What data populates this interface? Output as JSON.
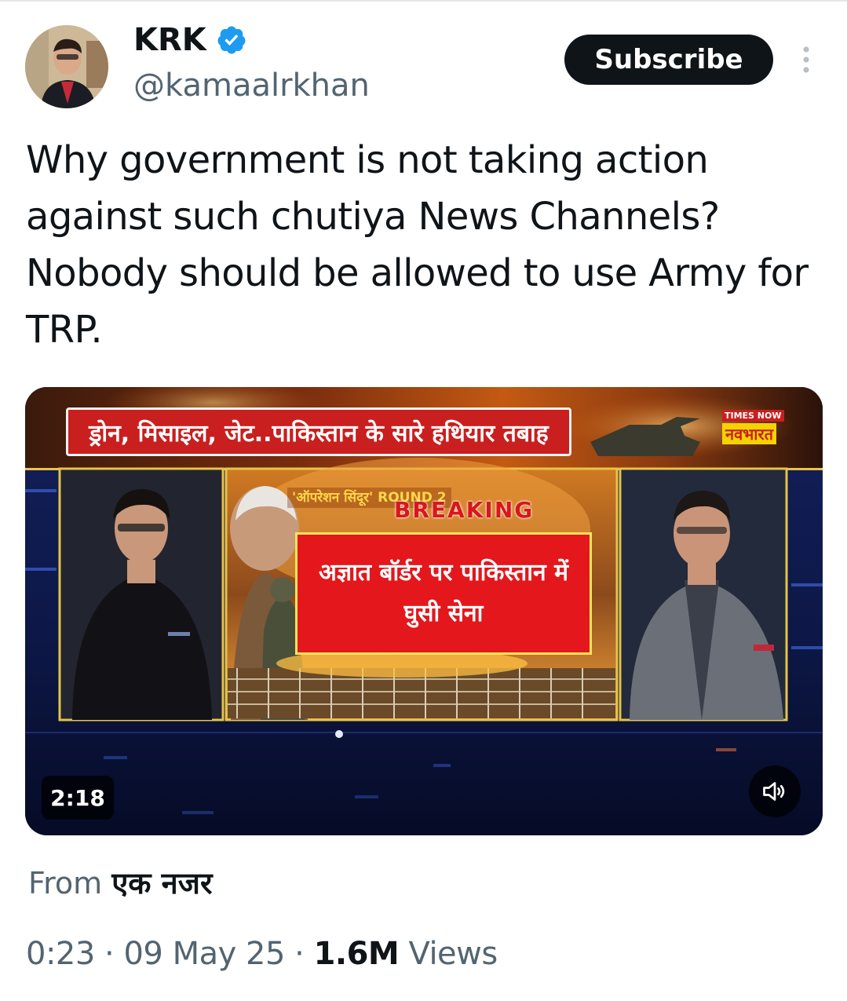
{
  "author": {
    "display_name": "KRK",
    "handle": "@kamaalrkhan",
    "verified": true,
    "avatar_icon": "profile-photo"
  },
  "actions": {
    "subscribe_label": "Subscribe",
    "more_icon": "more-vertical-icon"
  },
  "tweet": {
    "text": "Why government is not taking action against such chutiya News Channels? Nobody should be allowed to use Army for TRP."
  },
  "media": {
    "banner_text": "ड्रोन, मिसाइल, जेट..पाकिस्तान के सारे हथियार तबाह",
    "channel_top": "TIMES NOW",
    "channel_bottom": "नवभारत",
    "operation_tag": "'ऑपरेशन सिंदूर' ROUND 2",
    "breaking": "BREAKING",
    "headline": "अज्ञात बॉर्डर पर पाकिस्तान में घुसी सेना",
    "duration": "2:18",
    "mute_icon": "volume-muted-icon"
  },
  "source": {
    "prefix": "From",
    "name": "एक नजर"
  },
  "meta": {
    "time": "0:23",
    "date": "09 May 25",
    "views_count": "1.6M",
    "views_label": "Views",
    "separator": "·"
  },
  "colors": {
    "accent_verified": "#1d9bf0",
    "text_primary": "#0f1419",
    "text_secondary": "#536471",
    "breaking_red": "#e3171c"
  }
}
